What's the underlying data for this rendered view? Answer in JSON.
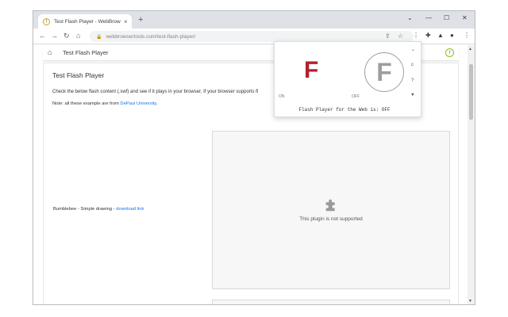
{
  "browser": {
    "tab_title": "Test Flash Player - WebBrowserT",
    "tab_favicon_letter": "f",
    "tab_close": "×",
    "new_tab": "+",
    "url": "webbrowsertools.com/test-flash-player/",
    "window_controls": {
      "chevron": "⌄",
      "minimize": "—",
      "maximize": "☐",
      "close": "✕"
    }
  },
  "site": {
    "header_title": "Test Flash Player",
    "logo_letter": "f",
    "page_title": "Test Flash Player",
    "description": "Check the below flash content (.swf) and see if it plays in your browser. If your browser supports fl",
    "note_prefix": "Note: all these example are from ",
    "note_link": "DePaul University",
    "note_suffix": ".",
    "example_label": "Bumblebee - Simple drawing - ",
    "download_link": "download link",
    "plugin_message": "This plugin is not supported"
  },
  "popup": {
    "on_letter": "F",
    "off_letter": "F",
    "on_label": "ON",
    "off_label": "OFF",
    "status": "Flash Player for the Web is: OFF",
    "side_icons": [
      "⌄",
      "c",
      "?",
      "♥"
    ],
    "colors": {
      "on_letter": "#b3202e",
      "off_letter": "#9e9e9e"
    }
  }
}
